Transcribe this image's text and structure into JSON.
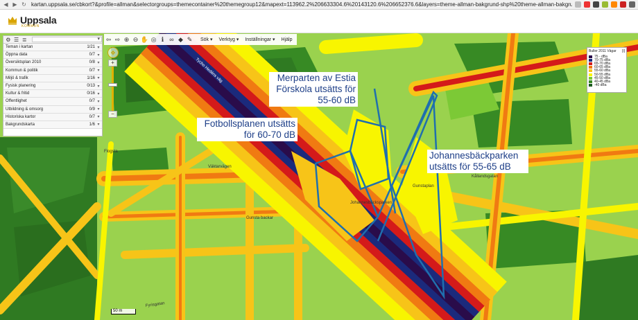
{
  "browser": {
    "url": "kartan.uppsala.se/cbkort?&profile=allman&selectorgroups=themecontainer%20themegroup12&mapext=113962.2%206633304.6%20143120.6%206652376.6&layers=theme-allman-bakgrund-shp%20theme-allman-bakgrund-shp-text%20theme-bullerkarta-vagar&profile",
    "back_icon": "arrow-left-icon",
    "forward_icon": "arrow-right-icon",
    "reload_icon": "reload-icon"
  },
  "header": {
    "logo_name": "Uppsala",
    "logo_sub": "KOMMUN",
    "logo_color": "#d9a400"
  },
  "toolbar": {
    "menus": [
      "Sök",
      "Verktyg",
      "Inställningar",
      "Hjälp"
    ],
    "tools": [
      {
        "name": "back-icon",
        "glyph": "⇦"
      },
      {
        "name": "forward-icon",
        "glyph": "⇨"
      },
      {
        "name": "zoom-in-icon",
        "glyph": "⊕"
      },
      {
        "name": "zoom-out-icon",
        "glyph": "⊖"
      },
      {
        "name": "pan-hand-icon",
        "glyph": "✋"
      },
      {
        "name": "globe-icon",
        "glyph": "◎"
      },
      {
        "name": "info-icon",
        "glyph": "ℹ"
      },
      {
        "name": "binoculars-icon",
        "glyph": "∞"
      },
      {
        "name": "car-icon",
        "glyph": "◆"
      },
      {
        "name": "pen-icon",
        "glyph": "✎"
      }
    ]
  },
  "sidebar": {
    "items": [
      {
        "label": "Teman i kartan",
        "count": "1/21"
      },
      {
        "label": "Öppna data",
        "count": "0/7"
      },
      {
        "label": "Översiktsplan 2010",
        "count": "0/8"
      },
      {
        "label": "Kommun & politik",
        "count": "0/7"
      },
      {
        "label": "Miljö & trafik",
        "count": "1/16"
      },
      {
        "label": "Fysisk planering",
        "count": "0/13"
      },
      {
        "label": "Kultur & fritid",
        "count": "0/16"
      },
      {
        "label": "Offentlighet",
        "count": "0/7"
      },
      {
        "label": "Utbildning & omsorg",
        "count": "0/9"
      },
      {
        "label": "Historiska kartor",
        "count": "0/7"
      },
      {
        "label": "Bakgrundskarta",
        "count": "1/6"
      }
    ]
  },
  "legend": {
    "title": "Buller 2011 Vägar",
    "items": [
      {
        "label": "75 - dBa",
        "color": "#2a0c4a"
      },
      {
        "label": "70-75 dBa",
        "color": "#1b2a7c"
      },
      {
        "label": "65-70 dBa",
        "color": "#d41a1a"
      },
      {
        "label": "60-65 dBa",
        "color": "#f07a12"
      },
      {
        "label": "55-60 dBa",
        "color": "#f7c418"
      },
      {
        "label": "50-55 dBa",
        "color": "#f8f500"
      },
      {
        "label": "45-50 dBa",
        "color": "#7cc936"
      },
      {
        "label": "40-45 dBa",
        "color": "#378a24"
      },
      {
        "label": "-40 dBa",
        "color": "#1c5c20"
      }
    ]
  },
  "callouts": {
    "estia": [
      "Merparten av Estia",
      "Förskola utsätts för",
      "55-60 dB"
    ],
    "fotboll": [
      "Fotbollsplanen utsätts",
      "för 60-70 dB"
    ],
    "johannes": [
      "Johannesbäckparken",
      "utsätts för 55-65 dB"
    ]
  },
  "map_labels": {
    "road1": "Tycho Hedéns väg",
    "road2": "Johannesbäcksparken",
    "street1": "Gunsta backar",
    "street2": "Väktarvägen",
    "street3": "Kållandsgatan",
    "street4": "Flogsta",
    "street5": "Gunstaplan",
    "street6": "Fyrisgatan"
  },
  "scale": {
    "label": "50 m"
  },
  "outline_color": "#1f6fae"
}
